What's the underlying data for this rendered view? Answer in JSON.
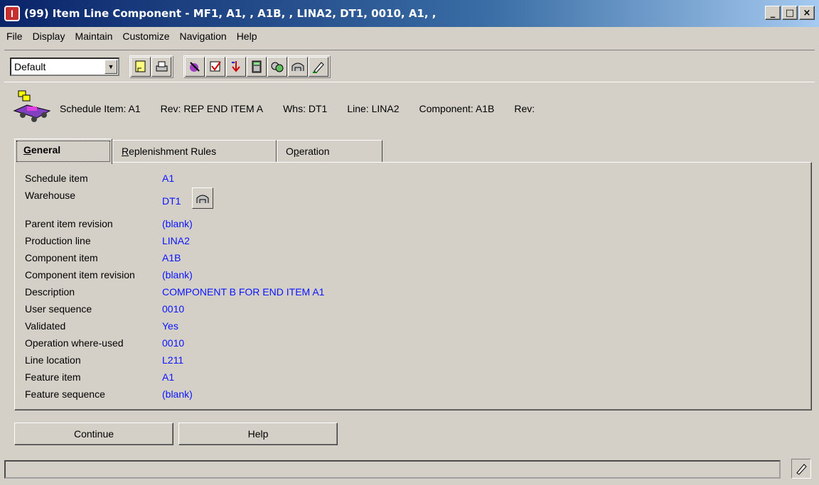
{
  "window": {
    "title": "(99) Item Line Component - MF1, A1, , A1B, , LINA2, DT1, 0010, A1, ,",
    "app_icon_letter": "I",
    "minimize": "_",
    "maximize": "□",
    "close": "×"
  },
  "menu": [
    "File",
    "Display",
    "Maintain",
    "Customize",
    "Navigation",
    "Help"
  ],
  "toolbar": {
    "view_select": "Default",
    "icons": [
      "notes-icon",
      "print-icon",
      "wizard-icon",
      "check-icon",
      "download-icon",
      "calculator-icon",
      "transfer-icon",
      "warehouse-icon",
      "edit-icon"
    ]
  },
  "header": {
    "schedule_item": "Schedule Item: A1",
    "rev1": "Rev:  REP END ITEM A",
    "whs": "Whs: DT1",
    "line": "Line: LINA2",
    "component": "Component: A1B",
    "rev2": "Rev:"
  },
  "tabs": [
    {
      "label_ul": "G",
      "label_rest": "eneral"
    },
    {
      "label_ul": "R",
      "label_rest": "eplenishment Rules"
    },
    {
      "label_pre": "O",
      "label_ul": "p",
      "label_rest": "eration"
    }
  ],
  "fields": [
    {
      "label": "Schedule item",
      "value": "A1"
    },
    {
      "label": "Warehouse",
      "value": "DT1"
    },
    {
      "label": "Parent item revision",
      "value": "(blank)"
    },
    {
      "label": "Production line",
      "value": "LINA2"
    },
    {
      "label": "Component item",
      "value": "A1B"
    },
    {
      "label": "Component item revision",
      "value": "(blank)"
    },
    {
      "label": "Description",
      "value": "COMPONENT B FOR END ITEM A1"
    },
    {
      "label": "User sequence",
      "value": "0010"
    },
    {
      "label": "Validated",
      "value": "Yes"
    },
    {
      "label": "Operation where-used",
      "value": "0010"
    },
    {
      "label": "Line location",
      "value": "L211"
    },
    {
      "label": "Feature item",
      "value": "A1"
    },
    {
      "label": "Feature sequence",
      "value": "(blank)"
    }
  ],
  "buttons": {
    "continue": "Continue",
    "help": "Help"
  },
  "status": {
    "text": ""
  }
}
